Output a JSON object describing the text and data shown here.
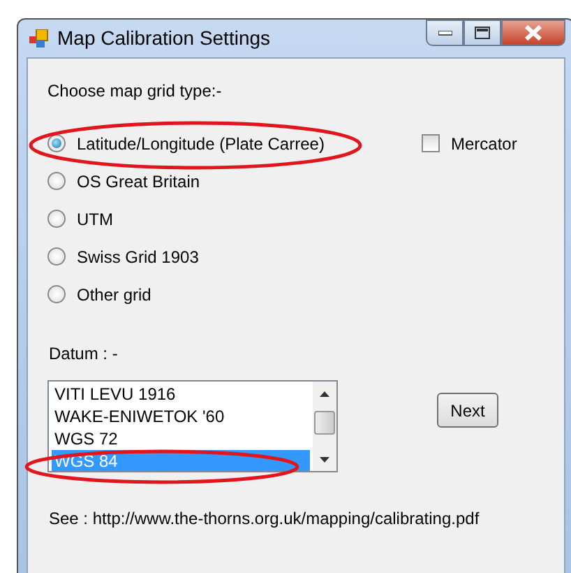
{
  "window": {
    "title": "Map Calibration Settings"
  },
  "grid_type_label": "Choose map grid type:-",
  "grid_types": [
    {
      "label": "Latitude/Longitude (Plate Carree)",
      "selected": true
    },
    {
      "label": "OS Great Britain",
      "selected": false
    },
    {
      "label": "UTM",
      "selected": false
    },
    {
      "label": "Swiss Grid 1903",
      "selected": false
    },
    {
      "label": "Other grid",
      "selected": false
    }
  ],
  "mercator": {
    "label": "Mercator",
    "checked": false
  },
  "datum_label": "Datum : -",
  "datum_list": [
    {
      "label": "VITI LEVU 1916",
      "selected": false
    },
    {
      "label": "WAKE-ENIWETOK '60",
      "selected": false
    },
    {
      "label": "WGS 72",
      "selected": false
    },
    {
      "label": "WGS 84",
      "selected": true
    }
  ],
  "next_button": "Next",
  "see_text": "See : http://www.the-thorns.org.uk/mapping/calibrating.pdf"
}
